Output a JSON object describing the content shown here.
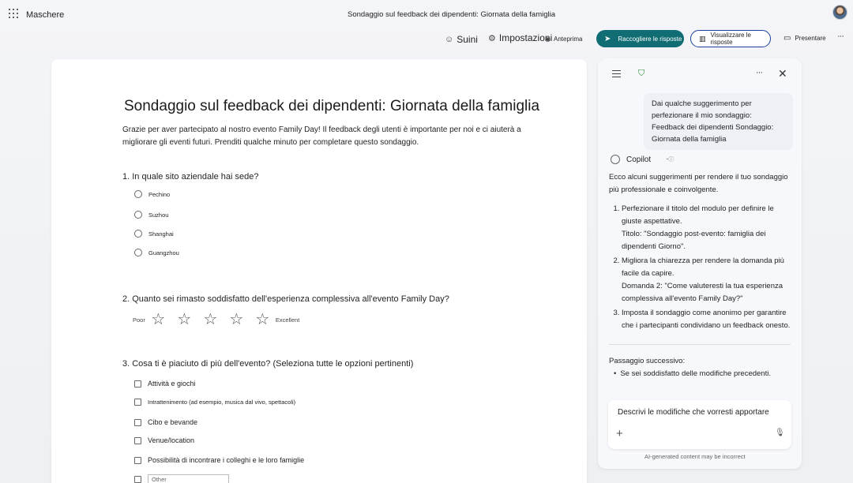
{
  "topbar": {
    "app_name": "Maschere",
    "doc_title": "Sondaggio sul feedback dei dipendenti: Giornata della famiglia"
  },
  "toolbar": {
    "suini": "Suini",
    "impostazioni": "Impostazioni",
    "anteprima": "Anteprima",
    "collect": "Raccogliere le risposte",
    "view": "Visualizzare le risposte",
    "present": "Presentare"
  },
  "form": {
    "title": "Sondaggio sul feedback dei dipendenti: Giornata della famiglia",
    "description": "Grazie per aver partecipato al nostro evento Family Day! Il feedback degli utenti è importante per noi e ci aiuterà a migliorare gli eventi futuri. Prenditi qualche minuto per completare questo sondaggio.",
    "q1": {
      "text": "1. In quale sito aziendale hai sede?",
      "options": [
        "Pechino",
        "Suzhou",
        "Shanghai",
        "Guangzhou"
      ]
    },
    "q2": {
      "text": "2.  Quanto sei rimasto soddisfatto dell'esperienza complessiva all'evento Family Day?",
      "low_label": "Poor",
      "high_label": "Excellent",
      "stars": 5
    },
    "q3": {
      "text": "3.  Cosa ti è piaciuto di più dell'evento? (Seleziona tutte le opzioni pertinenti)",
      "options": [
        "Attività e giochi",
        "Intrattenimento (ad esempio, musica dal vivo, spettacoli)",
        "Cibo e bevande",
        "Venue/location",
        "Possibilità di incontrare i colleghi e le loro famiglie"
      ],
      "other_placeholder": "Other"
    }
  },
  "copilot": {
    "user_message": "Dai qualche suggerimento per perfezionare il mio sondaggio: Feedback dei dipendenti Sondaggio: Giornata della famiglia",
    "name": "Copilot",
    "intro": "Ecco alcuni suggerimenti per rendere il tuo sondaggio più professionale e coinvolgente.",
    "suggestions": [
      {
        "main": "Perfezionare il titolo del modulo per definire le giuste aspettative.",
        "sub": "Titolo: \"Sondaggio post-evento: famiglia dei dipendenti Giorno\"."
      },
      {
        "main": "Migliora la chiarezza per rendere la domanda più facile da capire.",
        "sub": "Domanda 2: \"Come valuteresti la tua esperienza complessiva all'evento Family Day?\""
      },
      {
        "main": "Imposta il sondaggio come anonimo per garantire che i partecipanti condividano un feedback onesto.",
        "sub": ""
      }
    ],
    "next_step_label": "Passaggio successivo:",
    "next_step_item": "Se sei soddisfatto delle modifiche precedenti.",
    "prompt_placeholder": "Descrivi le modifiche che vorresti apportare",
    "disclaimer": "AI-generated content may be incorrect"
  }
}
